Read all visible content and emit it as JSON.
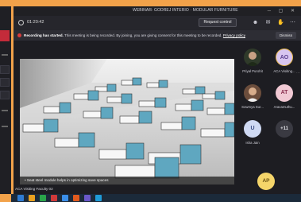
{
  "window": {
    "title": "WEBINAR: GODREJ INTERIO · MODULAR FURNITURE",
    "controls": "─ ▢ ✕"
  },
  "toolbar": {
    "timer": "01:20:42",
    "request_control_label": "Request control",
    "icons": [
      "people-icon",
      "chat-icon",
      "raise-hand-icon",
      "more-icon"
    ]
  },
  "banner": {
    "lead": "Recording has started.",
    "message": " This meeting is being recorded. By joining, you are giving consent for this meeting to be recorded.",
    "link": "Privacy policy",
    "dismiss_label": "Dismiss"
  },
  "stage": {
    "caption": "• Seat steel module helps in optimizing save spaces"
  },
  "participants": [
    {
      "name": "Priyal Purohit",
      "initials": "",
      "kind": "photo",
      "bg": "#2f3a2a"
    },
    {
      "name": "ACA Visiting...",
      "initials": "AO",
      "kind": "initials",
      "bg": "#d8c6f0",
      "fg": "#5a3f8f"
    },
    {
      "name": "Sowmya Sur...",
      "initials": "",
      "kind": "photo",
      "bg": "#4a3a30"
    },
    {
      "name": "Aravamuthu...",
      "initials": "AT",
      "kind": "initials",
      "bg": "#f1c9d4",
      "fg": "#8a3050"
    },
    {
      "name": "Isha Jain",
      "initials": "U",
      "kind": "initials",
      "bg": "#cfd9f3",
      "fg": "#3c4f86"
    },
    {
      "name": "",
      "initials": "+11",
      "kind": "count",
      "bg": "#3a3a42",
      "fg": "#e0e0e6"
    }
  ],
  "self": {
    "initials": "AP"
  },
  "signature": "ACA Visiting Faculty 02",
  "taskbar": {
    "apps": [
      "#2f7bd3",
      "#e8a020",
      "#2aa54a",
      "#d03a3a",
      "#3b8ee8",
      "#e05a1e",
      "#6a58c9",
      "#1f9bd7"
    ]
  }
}
